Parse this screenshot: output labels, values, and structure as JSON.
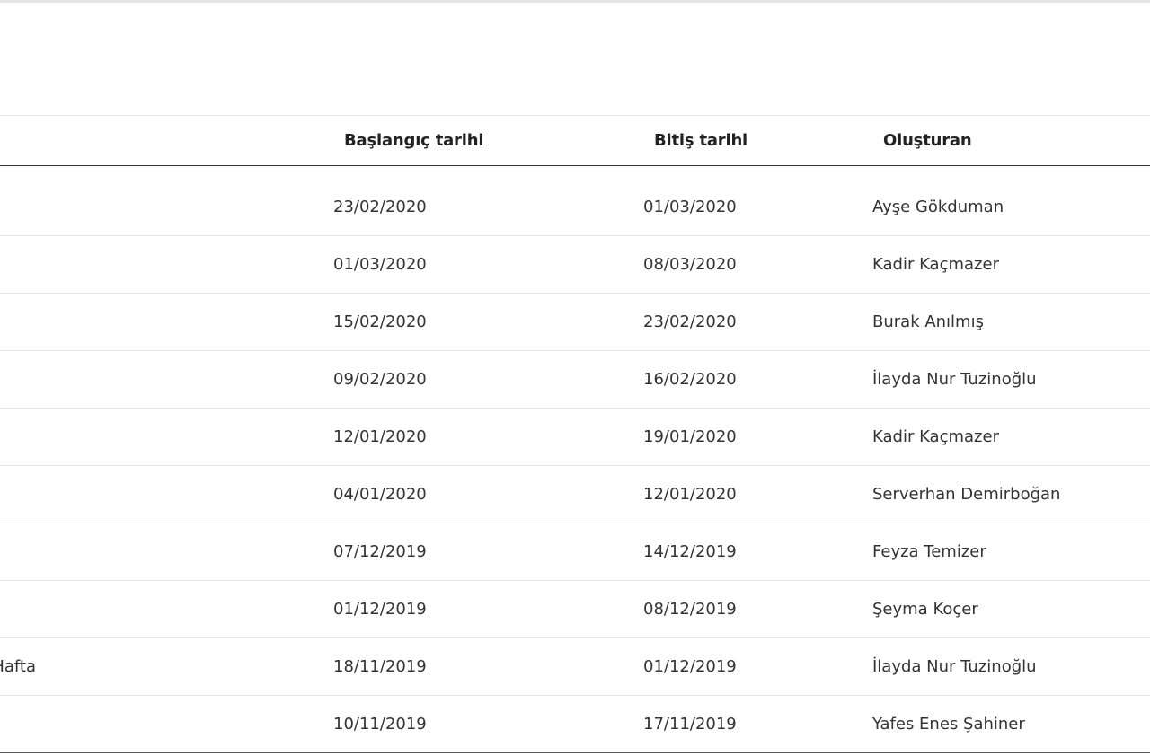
{
  "table": {
    "headers": {
      "start": "Başlangıç tarihi",
      "end": "Bitiş tarihi",
      "owner": "Oluşturan"
    },
    "rows": [
      {
        "title": "",
        "start": "23/02/2020",
        "end": "01/03/2020",
        "owner": "Ayşe Gökduman"
      },
      {
        "title": "",
        "start": "01/03/2020",
        "end": "08/03/2020",
        "owner": "Kadir Kaçmazer"
      },
      {
        "title": "",
        "start": "15/02/2020",
        "end": "23/02/2020",
        "owner": "Burak Anılmış"
      },
      {
        "title": "",
        "start": "09/02/2020",
        "end": "16/02/2020",
        "owner": "İlayda Nur Tuzinoğlu"
      },
      {
        "title": "",
        "start": "12/01/2020",
        "end": "19/01/2020",
        "owner": "Kadir Kaçmazer"
      },
      {
        "title": "",
        "start": "04/01/2020",
        "end": "12/01/2020",
        "owner": "Serverhan Demirboğan"
      },
      {
        "title": "",
        "start": "07/12/2019",
        "end": "14/12/2019",
        "owner": "Feyza Temizer"
      },
      {
        "title": "",
        "start": "01/12/2019",
        "end": "08/12/2019",
        "owner": "Şeyma Koçer"
      },
      {
        "title": "Hafta",
        "start": "18/11/2019",
        "end": "01/12/2019",
        "owner": "İlayda Nur Tuzinoğlu"
      },
      {
        "title": "",
        "start": "10/11/2019",
        "end": "17/11/2019",
        "owner": "Yafes Enes Şahiner"
      }
    ]
  }
}
